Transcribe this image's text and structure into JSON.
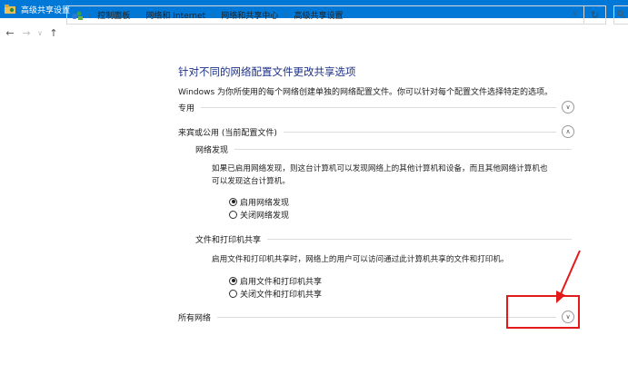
{
  "window": {
    "title": "高级共享设置"
  },
  "nav": {
    "back": "←",
    "forward": "→",
    "recent": "∨",
    "up": "↑"
  },
  "address": {
    "breadcrumbs": [
      "控制面板",
      "网络和 Internet",
      "网络和共享中心",
      "高级共享设置"
    ],
    "separator": "›",
    "dropdown": "∨",
    "refresh": "↻"
  },
  "page": {
    "heading": "针对不同的网络配置文件更改共享选项",
    "description": "Windows 为你所使用的每个网络创建单独的网络配置文件。你可以针对每个配置文件选择特定的选项。"
  },
  "profiles": {
    "private": {
      "label": "专用",
      "toggle": "∨"
    },
    "guest_public": {
      "label": "来宾或公用 (当前配置文件)",
      "toggle": "∧",
      "network_discovery": {
        "title": "网络发现",
        "text_line1": "如果已启用网络发现，则这台计算机可以发现网络上的其他计算机和设备，而且其他网络计算机也",
        "text_line2": "可以发现这台计算机。",
        "option_on": "启用网络发现",
        "option_off": "关闭网络发现",
        "selected": "on"
      },
      "file_printer_sharing": {
        "title": "文件和打印机共享",
        "text": "启用文件和打印机共享时，网络上的用户可以访问通过此计算机共享的文件和打印机。",
        "option_on": "启用文件和打印机共享",
        "option_off": "关闭文件和打印机共享",
        "selected": "on"
      }
    },
    "all_networks": {
      "label": "所有网络",
      "toggle": "∨"
    }
  },
  "colors": {
    "titlebar": "#0078d7",
    "heading": "#1e3287",
    "annotation": "#e21a1a"
  }
}
